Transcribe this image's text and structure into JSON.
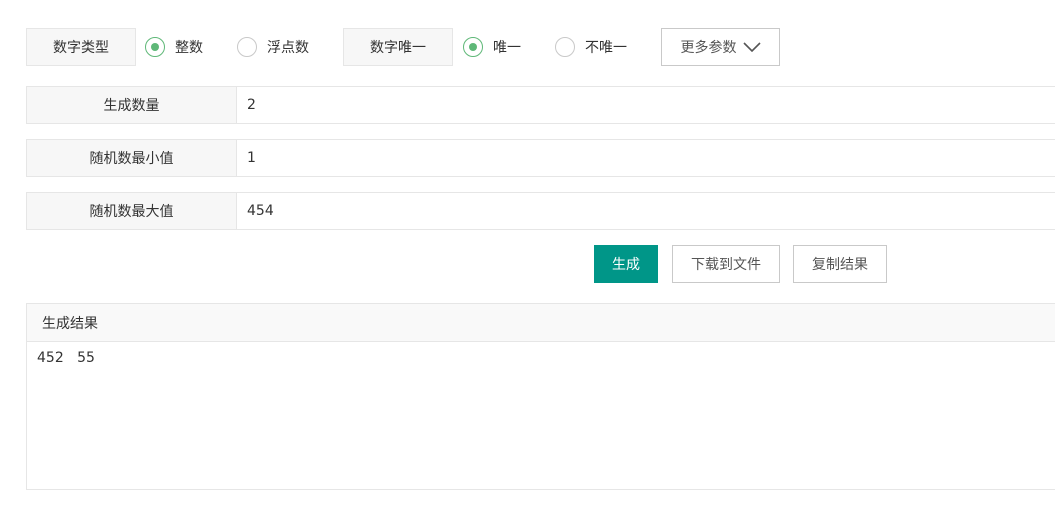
{
  "options": {
    "number_type": {
      "label": "数字类型",
      "choices": [
        {
          "label": "整数",
          "checked": true
        },
        {
          "label": "浮点数",
          "checked": false
        }
      ]
    },
    "unique": {
      "label": "数字唯一",
      "choices": [
        {
          "label": "唯一",
          "checked": true
        },
        {
          "label": "不唯一",
          "checked": false
        }
      ]
    },
    "more_params": {
      "label": "更多参数",
      "icon": "chevron-down-icon"
    }
  },
  "fields": [
    {
      "label": "生成数量",
      "value": "2"
    },
    {
      "label": "随机数最小值",
      "value": "1"
    },
    {
      "label": "随机数最大值",
      "value": "454"
    }
  ],
  "actions": {
    "generate": "生成",
    "download": "下载到文件",
    "copy": "复制结果"
  },
  "result": {
    "title": "生成结果",
    "content": "452   55"
  },
  "colors": {
    "primary": "#009688",
    "radio_checked": "#5fb878",
    "border": "#e6e6e6"
  }
}
